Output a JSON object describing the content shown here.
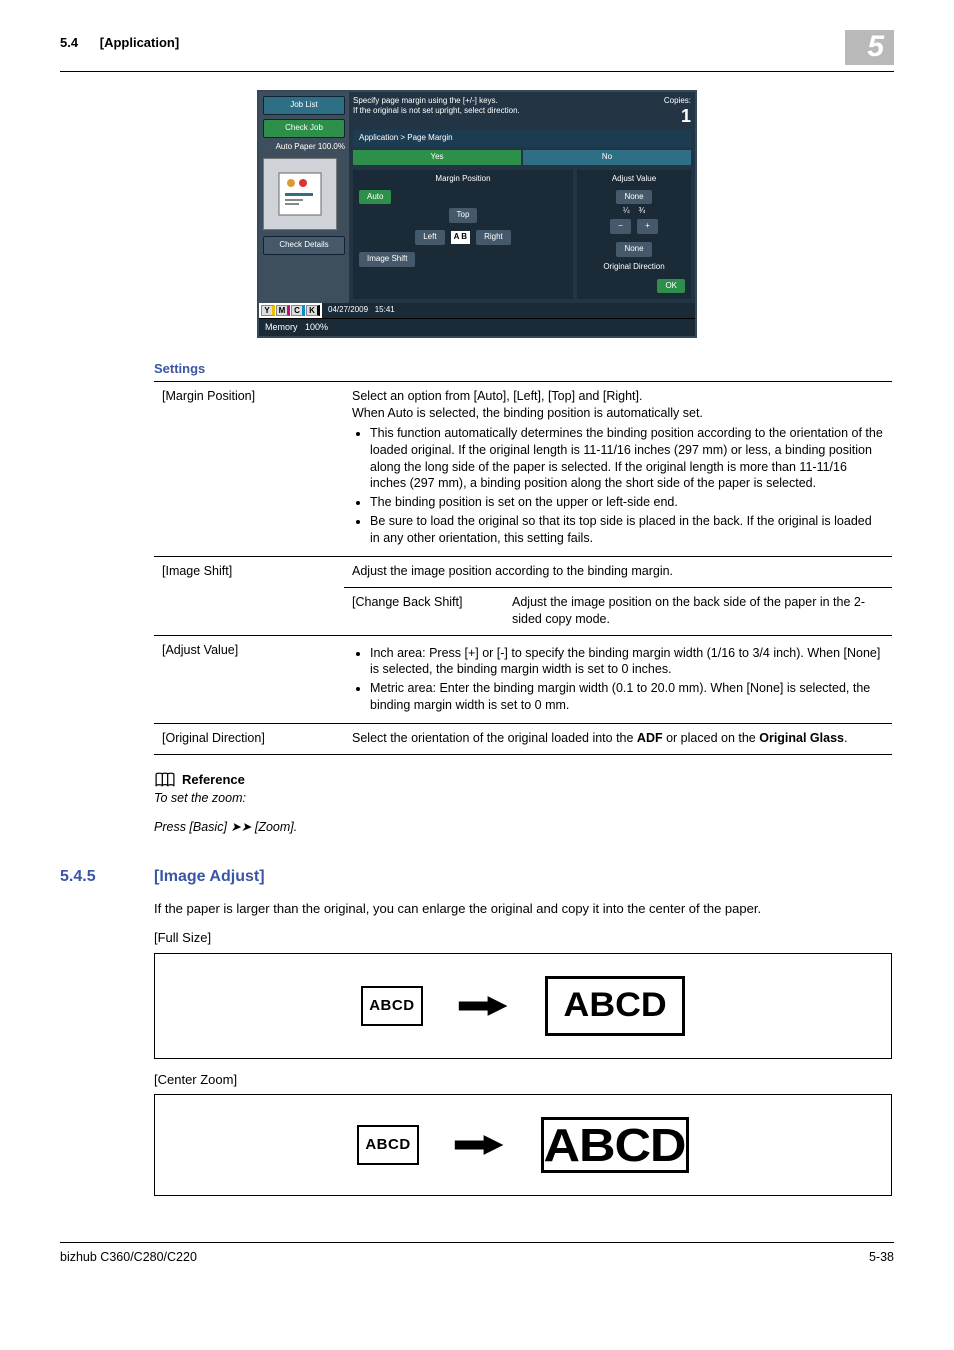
{
  "header": {
    "section_num": "5.4",
    "section_title": "[Application]",
    "chapter_num": "5"
  },
  "panel": {
    "job_list": "Job List",
    "check_job": "Check Job",
    "auto_paper": "Auto Paper",
    "ratio": "100.0%",
    "check_details": "Check Details",
    "instruction1": "Specify page margin using the [+/-] keys.",
    "instruction2": "If the original is not set upright, select direction.",
    "copies_label": "Copies:",
    "copies_value": "1",
    "breadcrumb": "Application > Page Margin",
    "tab_yes": "Yes",
    "tab_no": "No",
    "margin_position_hdr": "Margin Position",
    "adjust_value_hdr": "Adjust Value",
    "auto": "Auto",
    "top": "Top",
    "left": "Left",
    "right": "Right",
    "image_shift": "Image Shift",
    "none": "None",
    "original_direction": "Original Direction",
    "ok": "OK",
    "date": "04/27/2009",
    "time": "15:41",
    "memory": "Memory",
    "mem_pct": "100%",
    "toner": {
      "y": "Y",
      "m": "M",
      "c": "C",
      "k": "K"
    },
    "frac_left": "¼",
    "frac_right": "¾",
    "minus": "−",
    "plus": "+"
  },
  "settings": {
    "title": "Settings",
    "rows": {
      "margin_position": {
        "label": "[Margin Position]",
        "intro1": "Select an option from [Auto], [Left], [Top] and [Right].",
        "intro2": "When Auto is selected, the binding position is automatically set.",
        "b1": "This function automatically determines the binding position according to the orientation of the loaded original. If the original length is 11-11/16 inches (297 mm) or less, a binding position along the long side of the paper is selected. If the original length is more than 11-11/16 inches (297 mm), a binding position along the short side of the paper is selected.",
        "b2": "The binding position is set on the upper or left-side end.",
        "b3": "Be sure to load the original so that its top side is placed in the back. If the original is loaded in any other orientation, this setting fails."
      },
      "image_shift": {
        "label": "[Image Shift]",
        "desc": "Adjust the image position according to the binding margin.",
        "sub_label": "[Change Back Shift]",
        "sub_desc": "Adjust the image position on the back side of the paper in the 2-sided copy mode."
      },
      "adjust_value": {
        "label": "[Adjust Value]",
        "b1": "Inch area: Press [+] or [-] to specify the binding margin width (1/16 to 3/4 inch). When [None] is selected, the binding margin width is set to 0 inches.",
        "b2": "Metric area: Enter the binding margin width (0.1 to 20.0 mm). When [None] is selected, the binding margin width is set to 0 mm."
      },
      "original_direction": {
        "label": "[Original Direction]",
        "desc_pre": "Select the orientation of the original loaded into the ",
        "adf": "ADF",
        "desc_mid": " or placed on the ",
        "glass": "Original Glass",
        "desc_post": "."
      }
    }
  },
  "reference": {
    "title": "Reference",
    "line1": "To set the zoom:",
    "line2_a": "Press [Basic] ",
    "line2_b": " [Zoom]."
  },
  "section545": {
    "num": "5.4.5",
    "title": "[Image Adjust]",
    "para": "If the paper is larger than the original, you can enlarge the original and copy it into the center of the paper.",
    "full_size": "[Full Size]",
    "center_zoom": "[Center Zoom]",
    "abcd": "ABCD"
  },
  "footer": {
    "model": "bizhub C360/C280/C220",
    "page": "5-38"
  }
}
